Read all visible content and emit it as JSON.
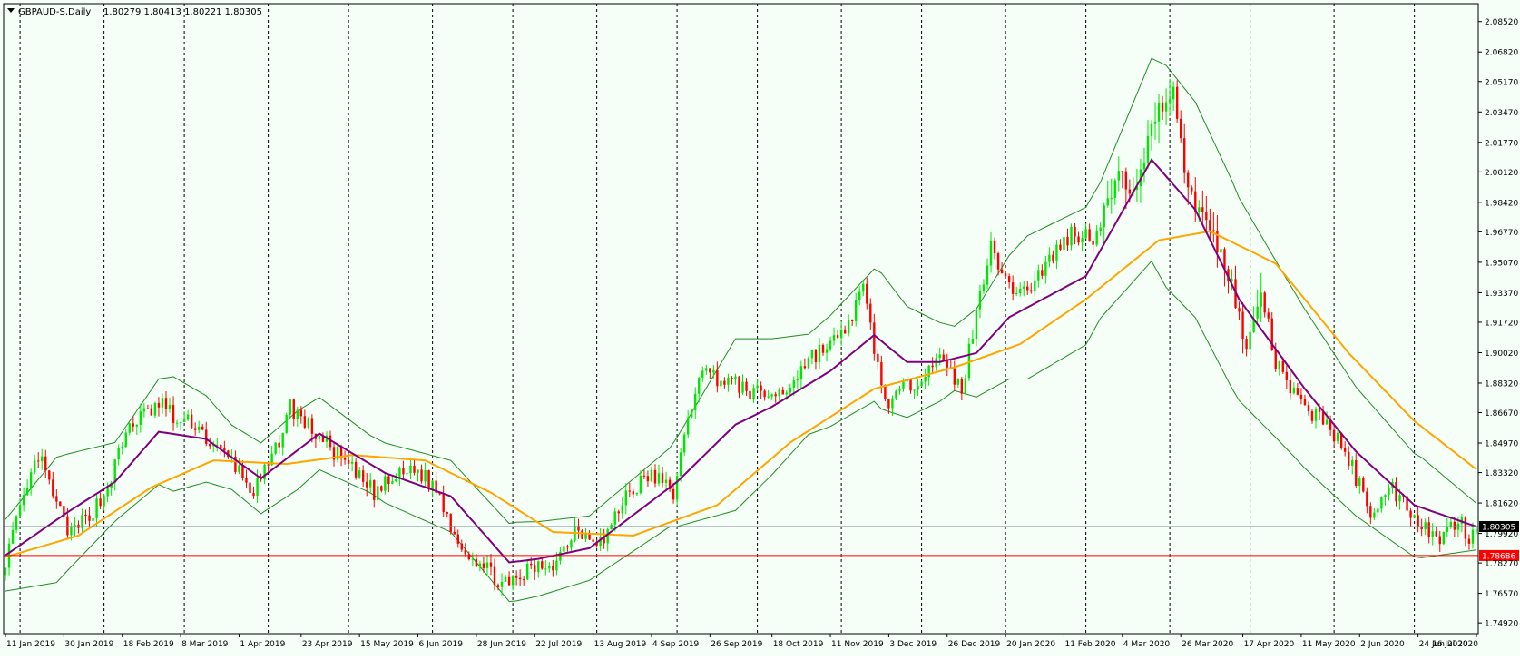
{
  "header": {
    "symbol_label": "GBPAUD-S,Daily",
    "ohlc_text": "1.80279 1.80413 1.80221 1.80305"
  },
  "colors": {
    "background": "#f5fff7",
    "bull_candle": "#00e600",
    "bear_candle": "#ff0000",
    "fast_ma": "#800080",
    "slow_ma": "#ffa500",
    "bands": "#228b22",
    "current_price_line": "#778899",
    "alert_line": "#ff0000"
  },
  "chart_data": {
    "type": "candlestick",
    "price_axis_ticks": [
      "2.08520",
      "2.06820",
      "2.05170",
      "2.03470",
      "2.01770",
      "2.00120",
      "1.98420",
      "1.96770",
      "1.95070",
      "1.93370",
      "1.91720",
      "1.90020",
      "1.88320",
      "1.86670",
      "1.84970",
      "1.83320",
      "1.81620",
      "1.79920",
      "1.78270",
      "1.76570",
      "1.74920"
    ],
    "ylim": [
      1.7432,
      2.0952
    ],
    "current_price": 1.80305,
    "current_price_label": "1.80305",
    "alert_price": 1.78686,
    "alert_price_label": "1.78686",
    "time_axis_labels": [
      "11 Jan 2019",
      "30 Jan 2019",
      "18 Feb 2019",
      "8 Mar 2019",
      "1 Apr 2019",
      "23 Apr 2019",
      "15 May 2019",
      "6 Jun 2019",
      "28 Jun 2019",
      "22 Jul 2019",
      "13 Aug 2019",
      "4 Sep 2019",
      "26 Sep 2019",
      "18 Oct 2019",
      "11 Nov 2019",
      "3 Dec 2019",
      "26 Dec 2019",
      "20 Jan 2020",
      "11 Feb 2020",
      "4 Mar 2020",
      "26 Mar 2020",
      "17 Apr 2020",
      "11 May 2020",
      "2 Jun 2020",
      "24 Jun 2020",
      "16 Jul 2020"
    ],
    "period_separator_count": 18,
    "price_path_anchors": [
      [
        0,
        1.785
      ],
      [
        9,
        1.843
      ],
      [
        14,
        1.815
      ],
      [
        18,
        1.798
      ],
      [
        27,
        1.82
      ],
      [
        34,
        1.86
      ],
      [
        43,
        1.872
      ],
      [
        47,
        1.861
      ],
      [
        52,
        1.861
      ],
      [
        57,
        1.847
      ],
      [
        62,
        1.84
      ],
      [
        68,
        1.822
      ],
      [
        73,
        1.84
      ],
      [
        78,
        1.87
      ],
      [
        84,
        1.857
      ],
      [
        90,
        1.845
      ],
      [
        96,
        1.832
      ],
      [
        101,
        1.822
      ],
      [
        106,
        1.829
      ],
      [
        112,
        1.836
      ],
      [
        118,
        1.824
      ],
      [
        124,
        1.795
      ],
      [
        131,
        1.78
      ],
      [
        138,
        1.769
      ],
      [
        143,
        1.778
      ],
      [
        151,
        1.784
      ],
      [
        156,
        1.802
      ],
      [
        164,
        1.795
      ],
      [
        170,
        1.821
      ],
      [
        177,
        1.832
      ],
      [
        183,
        1.822
      ],
      [
        190,
        1.89
      ],
      [
        197,
        1.885
      ],
      [
        206,
        1.877
      ],
      [
        213,
        1.877
      ],
      [
        220,
        1.897
      ],
      [
        229,
        1.909
      ],
      [
        235,
        1.935
      ],
      [
        241,
        1.872
      ],
      [
        248,
        1.882
      ],
      [
        255,
        1.898
      ],
      [
        262,
        1.88
      ],
      [
        267,
        1.932
      ],
      [
        270,
        1.964
      ],
      [
        274,
        1.938
      ],
      [
        280,
        1.935
      ],
      [
        287,
        1.955
      ],
      [
        292,
        1.967
      ],
      [
        298,
        1.965
      ],
      [
        305,
        1.999
      ],
      [
        310,
        1.989
      ],
      [
        314,
        2.03
      ],
      [
        320,
        2.048
      ],
      [
        324,
        1.99
      ],
      [
        330,
        1.97
      ],
      [
        336,
        1.94
      ],
      [
        340,
        1.9
      ],
      [
        344,
        1.935
      ],
      [
        348,
        1.894
      ],
      [
        355,
        1.87
      ],
      [
        362,
        1.862
      ],
      [
        368,
        1.84
      ],
      [
        374,
        1.812
      ],
      [
        380,
        1.824
      ],
      [
        386,
        1.81
      ],
      [
        392,
        1.796
      ],
      [
        396,
        1.802
      ],
      [
        398,
        1.809
      ],
      [
        401,
        1.797
      ],
      [
        403,
        1.804
      ]
    ],
    "fast_ma_anchors": [
      [
        0,
        1.787
      ],
      [
        17,
        1.811
      ],
      [
        30,
        1.828
      ],
      [
        42,
        1.856
      ],
      [
        55,
        1.852
      ],
      [
        70,
        1.83
      ],
      [
        86,
        1.855
      ],
      [
        104,
        1.833
      ],
      [
        122,
        1.82
      ],
      [
        138,
        1.783
      ],
      [
        146,
        1.785
      ],
      [
        160,
        1.791
      ],
      [
        184,
        1.828
      ],
      [
        200,
        1.86
      ],
      [
        210,
        1.87
      ],
      [
        226,
        1.89
      ],
      [
        238,
        1.91
      ],
      [
        247,
        1.895
      ],
      [
        256,
        1.895
      ],
      [
        266,
        1.9
      ],
      [
        275,
        1.92
      ],
      [
        296,
        1.943
      ],
      [
        314,
        2.008
      ],
      [
        326,
        1.98
      ],
      [
        338,
        1.93
      ],
      [
        356,
        1.88
      ],
      [
        370,
        1.845
      ],
      [
        386,
        1.815
      ],
      [
        403,
        1.803
      ]
    ],
    "slow_ma_anchors": [
      [
        0,
        1.786
      ],
      [
        20,
        1.798
      ],
      [
        40,
        1.825
      ],
      [
        57,
        1.84
      ],
      [
        77,
        1.838
      ],
      [
        95,
        1.843
      ],
      [
        115,
        1.84
      ],
      [
        133,
        1.822
      ],
      [
        150,
        1.8
      ],
      [
        172,
        1.798
      ],
      [
        195,
        1.815
      ],
      [
        215,
        1.85
      ],
      [
        238,
        1.88
      ],
      [
        260,
        1.892
      ],
      [
        278,
        1.905
      ],
      [
        296,
        1.93
      ],
      [
        316,
        1.963
      ],
      [
        330,
        1.968
      ],
      [
        348,
        1.95
      ],
      [
        368,
        1.9
      ],
      [
        386,
        1.862
      ],
      [
        403,
        1.835
      ]
    ],
    "band_width_anchors": [
      [
        0,
        0.02
      ],
      [
        14,
        0.035
      ],
      [
        30,
        0.022
      ],
      [
        46,
        0.032
      ],
      [
        62,
        0.018
      ],
      [
        80,
        0.022
      ],
      [
        100,
        0.016
      ],
      [
        122,
        0.02
      ],
      [
        140,
        0.022
      ],
      [
        160,
        0.018
      ],
      [
        182,
        0.022
      ],
      [
        200,
        0.048
      ],
      [
        220,
        0.028
      ],
      [
        240,
        0.038
      ],
      [
        260,
        0.018
      ],
      [
        280,
        0.04
      ],
      [
        300,
        0.038
      ],
      [
        318,
        0.062
      ],
      [
        336,
        0.058
      ],
      [
        350,
        0.048
      ],
      [
        370,
        0.036
      ],
      [
        388,
        0.028
      ],
      [
        403,
        0.013
      ]
    ]
  }
}
